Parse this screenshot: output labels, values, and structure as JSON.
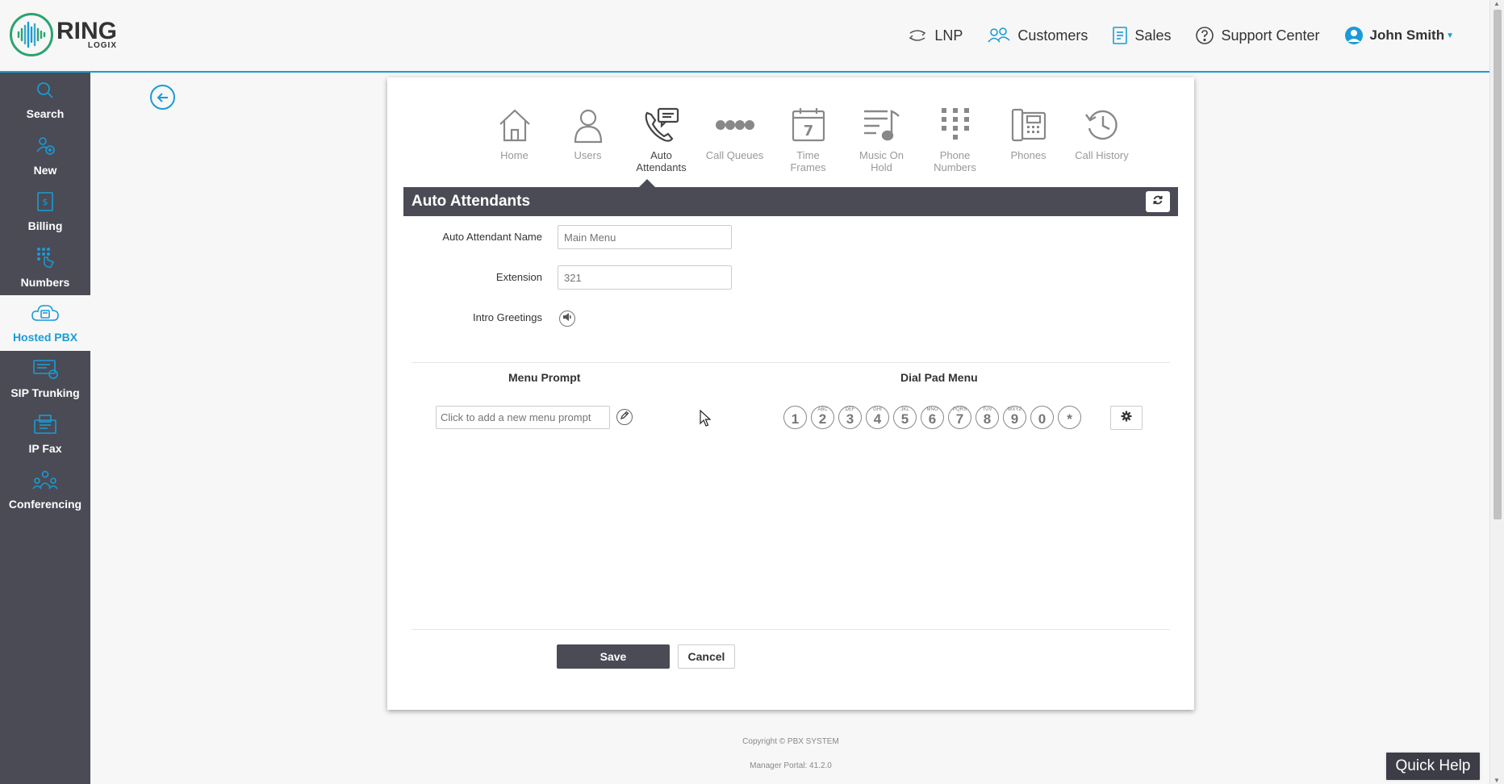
{
  "brand": {
    "name": "RING",
    "sub": "LOGIX"
  },
  "topnav": {
    "lnp": "LNP",
    "customers": "Customers",
    "sales": "Sales",
    "support": "Support Center",
    "user": "John Smith"
  },
  "sidebar": {
    "items": [
      {
        "label": "Search",
        "icon": "search-icon"
      },
      {
        "label": "New",
        "icon": "add-user-icon"
      },
      {
        "label": "Billing",
        "icon": "billing-icon"
      },
      {
        "label": "Numbers",
        "icon": "keypad-hand-icon"
      },
      {
        "label": "Hosted PBX",
        "icon": "cloud-phone-icon",
        "active": true
      },
      {
        "label": "SIP Trunking",
        "icon": "sip-trunk-icon"
      },
      {
        "label": "IP Fax",
        "icon": "fax-icon"
      },
      {
        "label": "Conferencing",
        "icon": "conference-icon"
      }
    ]
  },
  "tabs": [
    {
      "label": "Home"
    },
    {
      "label": "Users"
    },
    {
      "label": "Auto Attendants",
      "active": true
    },
    {
      "label": "Call Queues"
    },
    {
      "label": "Time Frames",
      "icon_text": "7"
    },
    {
      "label": "Music On Hold"
    },
    {
      "label": "Phone Numbers"
    },
    {
      "label": "Phones"
    },
    {
      "label": "Call History"
    }
  ],
  "section": {
    "title": "Auto Attendants"
  },
  "form": {
    "name_label": "Auto Attendant Name",
    "name_value": "Main Menu",
    "extension_label": "Extension",
    "extension_value": "321",
    "greetings_label": "Intro Greetings"
  },
  "menu_prompt": {
    "title": "Menu Prompt",
    "placeholder": "Click to add a new menu prompt"
  },
  "dialpad": {
    "title": "Dial Pad Menu",
    "keys": [
      {
        "num": "1",
        "sub": ""
      },
      {
        "num": "2",
        "sub": "ABC"
      },
      {
        "num": "3",
        "sub": "DEF"
      },
      {
        "num": "4",
        "sub": "GHI"
      },
      {
        "num": "5",
        "sub": "JKL"
      },
      {
        "num": "6",
        "sub": "MNO"
      },
      {
        "num": "7",
        "sub": "PQRS"
      },
      {
        "num": "8",
        "sub": "TUV"
      },
      {
        "num": "9",
        "sub": "WXYZ"
      },
      {
        "num": "0",
        "sub": ""
      },
      {
        "num": "*",
        "sub": ""
      }
    ]
  },
  "buttons": {
    "save": "Save",
    "cancel": "Cancel"
  },
  "footer": {
    "copyright": "Copyright © PBX SYSTEM",
    "version": "Manager Portal: 41.2.0"
  },
  "quick_help": "Quick Help",
  "colors": {
    "accent": "#1a9bd7",
    "sidebar": "#4a4b55",
    "brand_green": "#2aa46e"
  }
}
